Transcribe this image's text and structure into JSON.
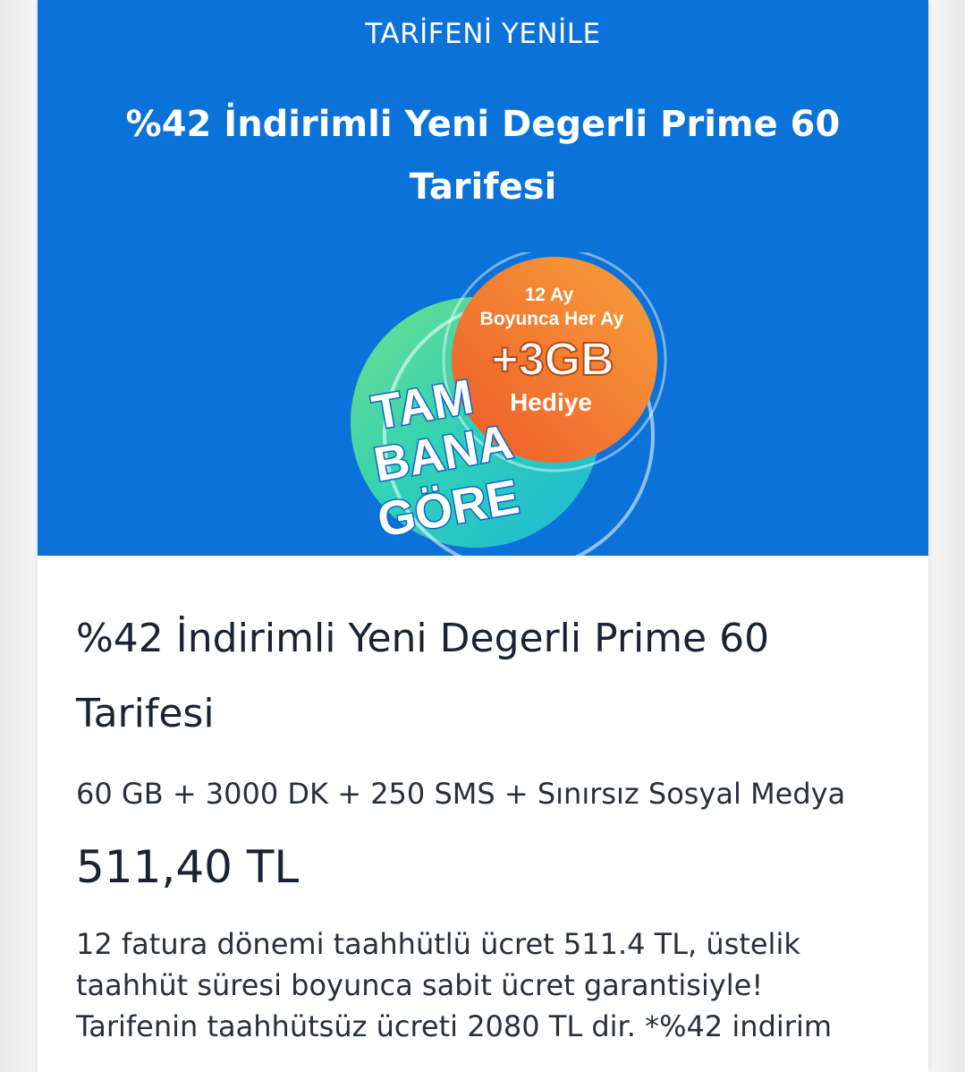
{
  "hero": {
    "kicker": "TARİFENİ YENİLE",
    "title": "%42 İndirimli Yeni Degerli Prime 60 Tarifesi",
    "background_color": "#0a72d8"
  },
  "badge": {
    "line1": "12 Ay",
    "line2": "Boyunca Her Ay",
    "amount": "+3GB",
    "gift": "Hediye",
    "brand_line1": "TAM",
    "brand_line2": "BANA",
    "brand_line3": "GÖRE",
    "orange": "#f07a1f",
    "teal": "#22c5c8",
    "green": "#4fd07d"
  },
  "plan": {
    "name": "%42 İndirimli Yeni Degerli Prime 60 Tarifesi",
    "features": "60 GB + 3000 DK + 250 SMS + Sınırsız Sosyal Medya",
    "price": "511,40 TL",
    "description": "12 fatura dönemi taahhütlü ücret 511.4 TL, üstelik taahhüt süresi boyunca sabit ücret garantisiyle! Tarifenin taahhütsüz ücreti 2080 TL dir. *%42 indirim"
  }
}
